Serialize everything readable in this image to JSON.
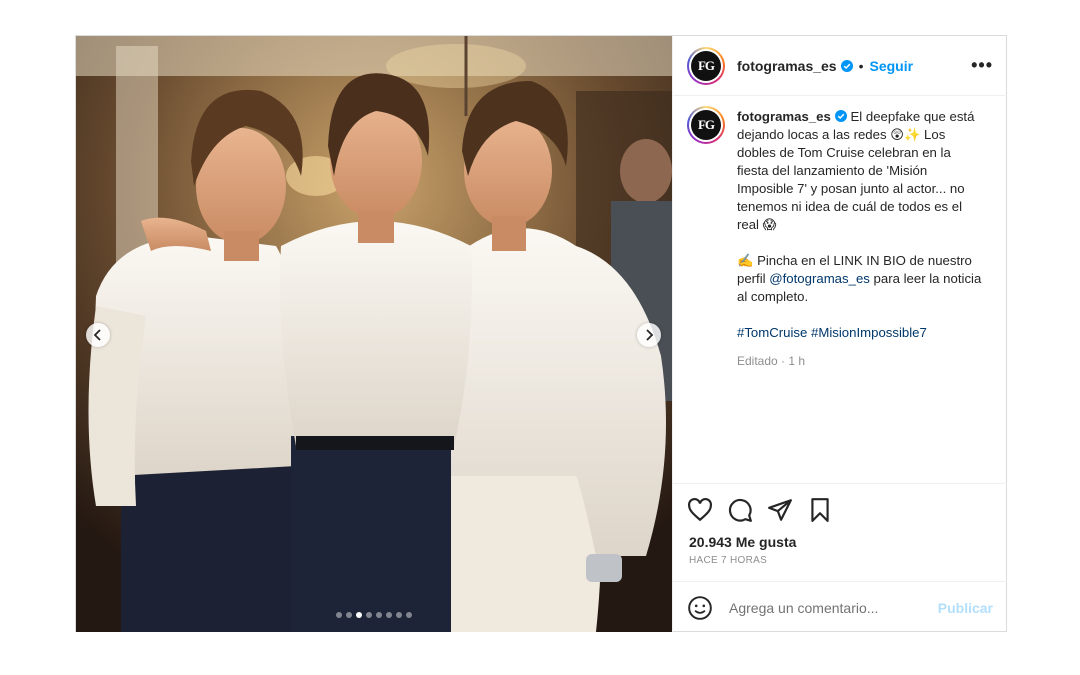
{
  "post": {
    "username": "fotogramas_es",
    "avatar_text": "FG",
    "follow_label": "Seguir",
    "separator": "•",
    "more_label": "•••",
    "caption": {
      "line1": "El deepfake que está dejando locas a las redes 😲✨ Los dobles de Tom Cruise celebran en la fiesta del lanzamiento de 'Misión Imposible 7' y posan junto al actor... no tenemos ni idea de cuál de todos es el real 😱",
      "line2_prefix": "✍️ Pincha en el LINK IN BIO de nuestro perfil ",
      "mention": "@fotogramas_es",
      "line2_suffix": " para leer la noticia al completo.",
      "hashtags": "#TomCruise #MisionImpossible7"
    },
    "edited_label": "Editado · 1 h",
    "likes": "20.943 Me gusta",
    "timestamp": "HACE 7 HORAS",
    "comment_placeholder": "Agrega un comentario...",
    "publish_label": "Publicar",
    "carousel": {
      "total": 8,
      "active_index": 2
    },
    "colors": {
      "accent": "#0095f6",
      "publish_disabled": "#b2dffc",
      "link": "#00376b"
    },
    "icons": [
      "heart-icon",
      "comment-icon",
      "share-icon",
      "bookmark-icon",
      "emoji-icon",
      "verified-icon",
      "chevron-left-icon",
      "chevron-right-icon"
    ]
  }
}
